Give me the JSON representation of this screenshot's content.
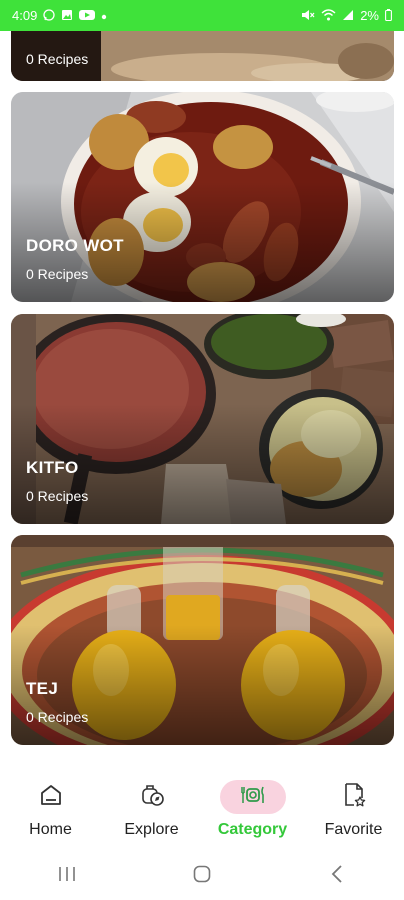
{
  "status_bar": {
    "time": "4:09",
    "battery": "2%",
    "left_icons": [
      "whatsapp-icon",
      "image-icon",
      "youtube-icon",
      "dot-icon"
    ],
    "right_icons": [
      "mute-icon",
      "wifi-icon",
      "signal-icon",
      "battery-icon"
    ]
  },
  "categories": [
    {
      "title": "",
      "count": "0 Recipes"
    },
    {
      "title": "DORO WOT",
      "count": "0 Recipes"
    },
    {
      "title": "KITFO",
      "count": "0 Recipes"
    },
    {
      "title": "TEJ",
      "count": "0 Recipes"
    }
  ],
  "bottom_nav": {
    "items": [
      {
        "label": "Home",
        "icon": "home-icon",
        "active": false
      },
      {
        "label": "Explore",
        "icon": "explore-icon",
        "active": false
      },
      {
        "label": "Category",
        "icon": "utensils-icon",
        "active": true
      },
      {
        "label": "Favorite",
        "icon": "favorite-page-icon",
        "active": false
      }
    ]
  },
  "system_nav": {
    "buttons": [
      "recents-button",
      "home-button",
      "back-button"
    ]
  },
  "colors": {
    "accent_green": "#3fe23a",
    "active_label": "#34c83a",
    "active_pill": "#f9d3df"
  }
}
